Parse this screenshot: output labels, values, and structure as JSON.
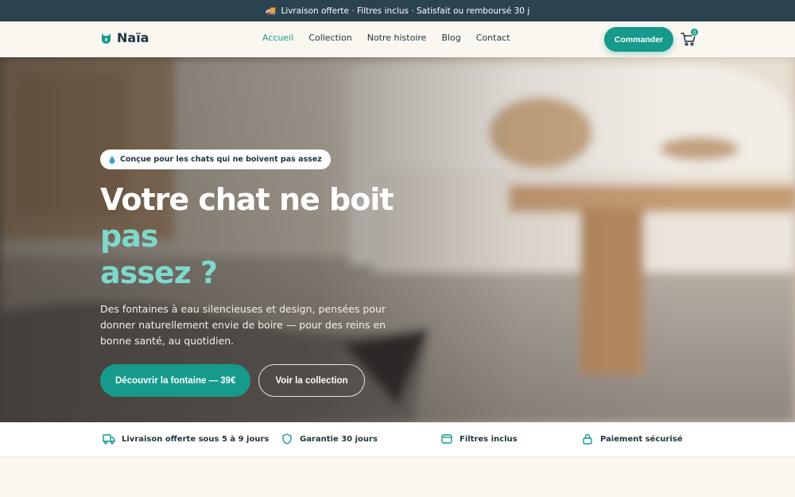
{
  "announcement": {
    "emoji": "🚚",
    "text": "Livraison offerte · Filtres inclus · Satisfait ou remboursé 30 j"
  },
  "brand": {
    "name": "Naïa"
  },
  "nav": {
    "items": [
      {
        "label": "Accueil",
        "active": true
      },
      {
        "label": "Collection",
        "active": false
      },
      {
        "label": "Notre histoire",
        "active": false
      },
      {
        "label": "Blog",
        "active": false
      },
      {
        "label": "Contact",
        "active": false
      }
    ]
  },
  "header": {
    "order_label": "Commander",
    "cart_count": "0"
  },
  "hero": {
    "badge": "Conçue pour les chats qui ne boivent pas assez",
    "headline_part1": "Votre chat ne boit ",
    "headline_accent1": "pas",
    "headline_accent2": "assez ?",
    "subtext": "Des fontaines à eau silencieuses et design, pensées pour donner naturellement envie de boire — pour des reins en bonne santé, au quotidien.",
    "primary_cta": "Découvrir la fontaine — 39€",
    "secondary_cta": "Voir la collection"
  },
  "features": [
    {
      "icon": "truck-icon",
      "label": "Livraison offerte sous 5 à 9 jours"
    },
    {
      "icon": "shield-icon",
      "label": "Garantie 30 jours"
    },
    {
      "icon": "filter-icon",
      "label": "Filtres inclus"
    },
    {
      "icon": "lock-icon",
      "label": "Paiement sécurisé"
    }
  ],
  "colors": {
    "brand_teal": "#159a8c",
    "accent_mint": "#7fd8cc",
    "navy": "#2b4251",
    "cream": "#faf6f0"
  }
}
